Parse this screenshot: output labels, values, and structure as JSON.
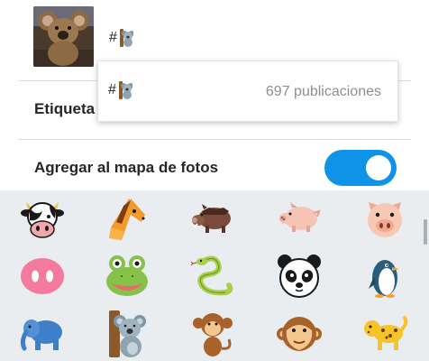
{
  "compose": {
    "hashtag_symbol": "#",
    "emoji_name": "koala"
  },
  "rows": {
    "tag_label": "Etiqueta",
    "map_label": "Agregar al mapa de fotos",
    "map_toggle_on": true
  },
  "suggestion": {
    "hashtag_symbol": "#",
    "emoji_name": "koala",
    "count_text": "697 publicaciones"
  },
  "keyboard": {
    "emojis": [
      [
        "cow",
        "horse",
        "boar",
        "pig",
        "pig-face"
      ],
      [
        "pig-nose",
        "frog",
        "snake",
        "panda",
        "penguin"
      ],
      [
        "elephant",
        "koala",
        "monkey",
        "monkey-face",
        "leopard"
      ]
    ]
  },
  "colors": {
    "toggle_on": "#0f93e8",
    "keyboard_bg": "#e9edf0",
    "count_text": "#8e8e8e"
  }
}
